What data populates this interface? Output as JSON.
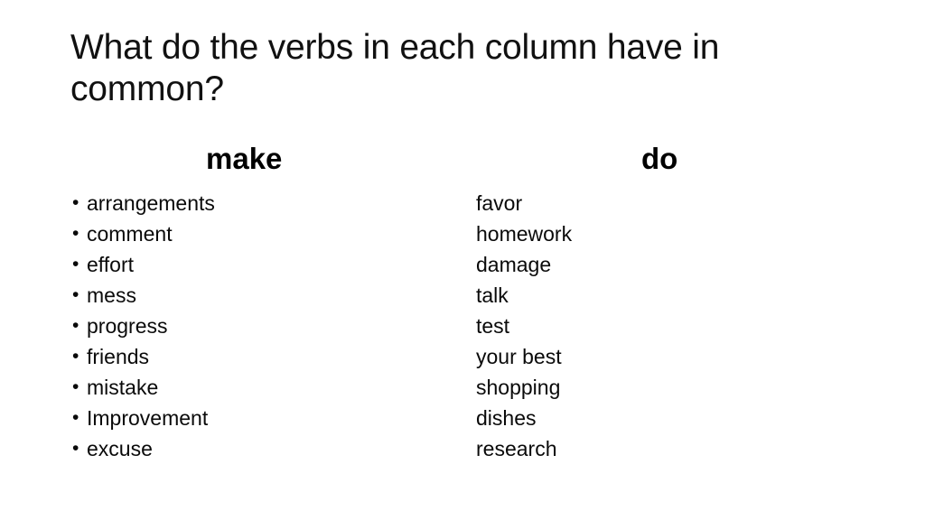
{
  "slide": {
    "background_color": "#ffffff",
    "text_color": "#000000",
    "title": "What do the verbs in each column have in common?"
  },
  "columns": [
    {
      "header": "make",
      "bulleted": true,
      "items": [
        "arrangements",
        "comment",
        "effort",
        "mess",
        "progress",
        "friends",
        "mistake",
        "Improvement",
        "excuse"
      ]
    },
    {
      "header": "do",
      "bulleted": false,
      "items": [
        "favor",
        "homework",
        "damage",
        "talk",
        "test",
        "your best",
        "shopping",
        "dishes",
        "research"
      ]
    }
  ],
  "bullet_glyph": "•"
}
